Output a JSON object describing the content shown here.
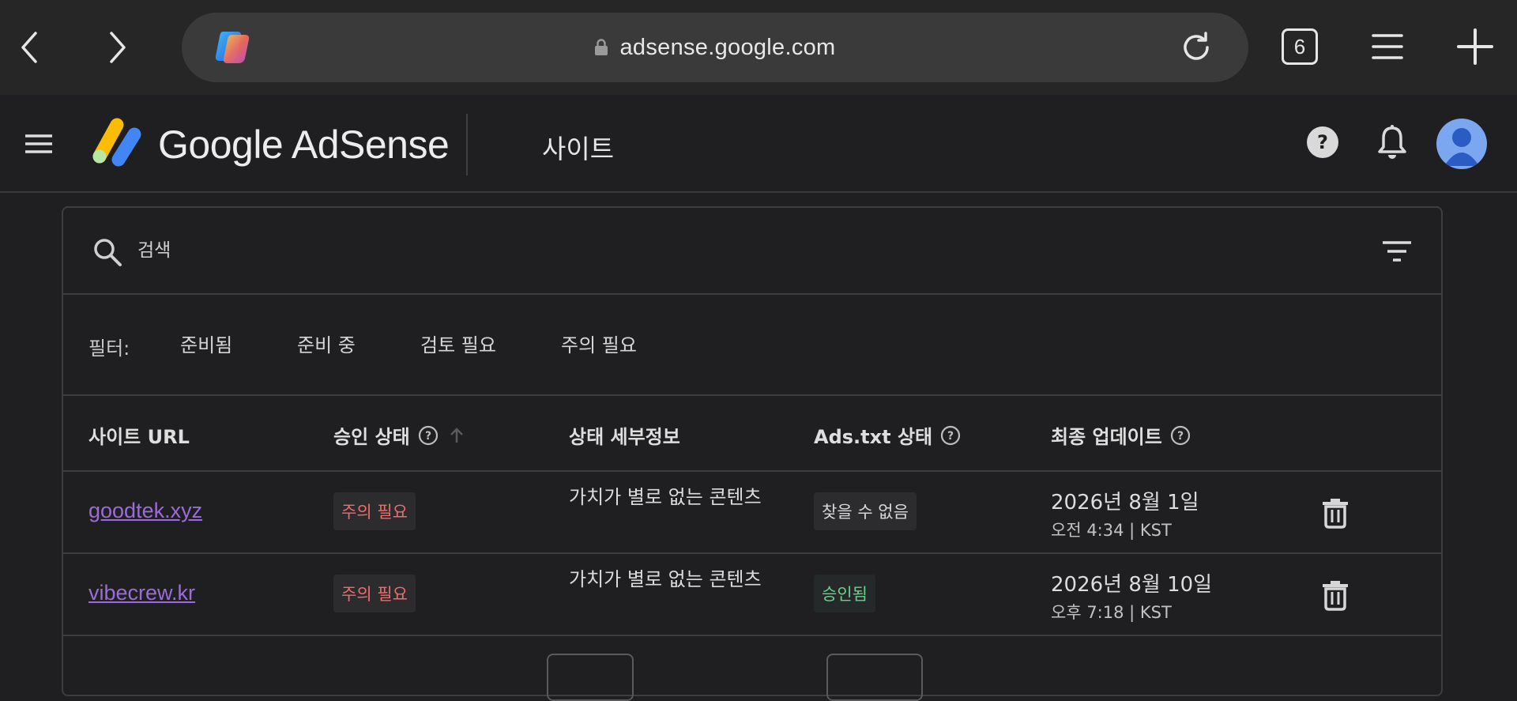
{
  "browser": {
    "url": "adsense.google.com",
    "tab_count": "6"
  },
  "header": {
    "brand": "Google AdSense",
    "page_title": "사이트"
  },
  "search": {
    "placeholder": "검색"
  },
  "filters": {
    "label": "필터:",
    "chips": [
      "준비됨",
      "준비 중",
      "검토 필요",
      "주의 필요"
    ]
  },
  "table": {
    "columns": [
      "사이트 URL",
      "승인 상태",
      "상태 세부정보",
      "Ads.txt 상태",
      "최종 업데이트"
    ],
    "rows": [
      {
        "site": "goodtek.xyz",
        "approval": "주의 필요",
        "detail": "가치가 별로 없는 콘텐츠",
        "ads_txt": "찾을 수 없음",
        "date": "2026년 8월 1일",
        "time": "오전 4:34 | KST"
      },
      {
        "site": "vibecrew.kr",
        "approval": "주의 필요",
        "detail": "가치가 별로 없는 콘텐츠",
        "ads_txt": "승인됨",
        "date": "2026년 8월 10일",
        "time": "오후 7:18 | KST"
      }
    ]
  },
  "colors": {
    "background": "#1f1f21",
    "link": "#9b6cd8",
    "warning": "#f06b6b",
    "approved": "#69d38b"
  },
  "icons": [
    "back-icon",
    "forward-icon",
    "copilot-icon",
    "lock-icon",
    "reload-icon",
    "tabs-icon",
    "menu-icon",
    "new-tab-icon",
    "hamburger-icon",
    "adsense-logo",
    "help-icon",
    "bell-icon",
    "avatar-icon",
    "search-icon",
    "filter-icon",
    "info-icon",
    "sort-arrow-icon",
    "trash-icon"
  ]
}
